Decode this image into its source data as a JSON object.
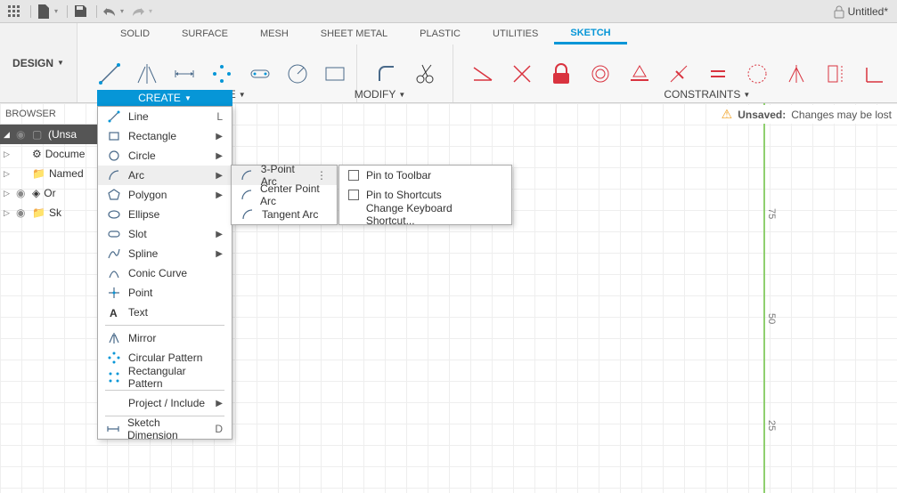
{
  "title": "Untitled*",
  "design_label": "DESIGN",
  "tabs": [
    "SOLID",
    "SURFACE",
    "MESH",
    "SHEET METAL",
    "PLASTIC",
    "UTILITIES",
    "SKETCH"
  ],
  "active_tab": "SKETCH",
  "group_labels": {
    "create": "CREATE",
    "modify": "MODIFY",
    "constraints": "CONSTRAINTS"
  },
  "browser": {
    "header": "BROWSER",
    "root": "(Unsa",
    "rows": [
      {
        "icon": "gear",
        "label": "Docume"
      },
      {
        "icon": "folder",
        "label": "Named  "
      },
      {
        "icon": "layers",
        "label": "Or"
      },
      {
        "icon": "folder",
        "label": "Sk"
      }
    ]
  },
  "unsaved": {
    "label": "Unsaved:",
    "msg": "Changes may be lost"
  },
  "ruler": [
    "75",
    "50",
    "25"
  ],
  "create_menu": [
    {
      "icon": "line",
      "label": "Line",
      "shortcut": "L"
    },
    {
      "icon": "rect",
      "label": "Rectangle",
      "sub": true
    },
    {
      "icon": "circle",
      "label": "Circle",
      "sub": true
    },
    {
      "icon": "arc",
      "label": "Arc",
      "sub": true,
      "hover": true
    },
    {
      "icon": "poly",
      "label": "Polygon",
      "sub": true
    },
    {
      "icon": "ellipse",
      "label": "Ellipse"
    },
    {
      "icon": "slot",
      "label": "Slot",
      "sub": true
    },
    {
      "icon": "spline",
      "label": "Spline",
      "sub": true
    },
    {
      "icon": "conic",
      "label": "Conic Curve"
    },
    {
      "icon": "point",
      "label": "Point"
    },
    {
      "icon": "text",
      "label": "Text"
    },
    {
      "sep": true
    },
    {
      "icon": "mirror",
      "label": "Mirror"
    },
    {
      "icon": "circpat",
      "label": "Circular Pattern"
    },
    {
      "icon": "rectpat",
      "label": "Rectangular Pattern"
    },
    {
      "sep": true
    },
    {
      "icon": "",
      "label": "Project / Include",
      "sub": true
    },
    {
      "sep": true
    },
    {
      "icon": "dim",
      "label": "Sketch Dimension",
      "shortcut": "D"
    }
  ],
  "arc_submenu": [
    {
      "label": "3-Point Arc",
      "hl": true
    },
    {
      "label": "Center Point Arc"
    },
    {
      "label": "Tangent Arc"
    }
  ],
  "ctx_menu": [
    {
      "check": true,
      "label": "Pin to Toolbar"
    },
    {
      "check": true,
      "label": "Pin to Shortcuts"
    },
    {
      "check": false,
      "label": "Change Keyboard Shortcut..."
    }
  ]
}
